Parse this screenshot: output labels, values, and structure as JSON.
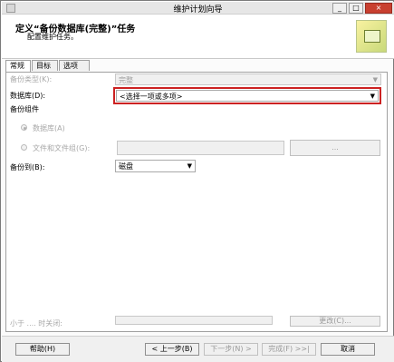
{
  "window": {
    "title": "维护计划向导",
    "minimize": "_",
    "maximize": "□",
    "close": "×"
  },
  "header": {
    "title": "定义“备份数据库(完整)”任务",
    "subtitle": "配置维护任务。"
  },
  "tabs": [
    "常规",
    "目标",
    "选项"
  ],
  "form": {
    "backup_type_label": "备份类型(K):",
    "backup_type_value": "完整",
    "database_label": "数据库(D):",
    "database_value": "<选择一项或多项>",
    "backup_component_label": "备份组件",
    "radio_database_label": "数据库(A)",
    "radio_files_label": "文件和文件组(G):",
    "browse_label": "...",
    "backup_to_label": "备份到(B):",
    "backup_to_value": "磁盘",
    "partial_left_text": "小于 .... 时关闭:",
    "partial_right_text": "更改(C)..."
  },
  "buttons": {
    "help": "帮助(H)",
    "back": "< 上一步(B)",
    "next": "下一步(N) >",
    "finish": "完成(F) >>|",
    "cancel": "取消"
  }
}
